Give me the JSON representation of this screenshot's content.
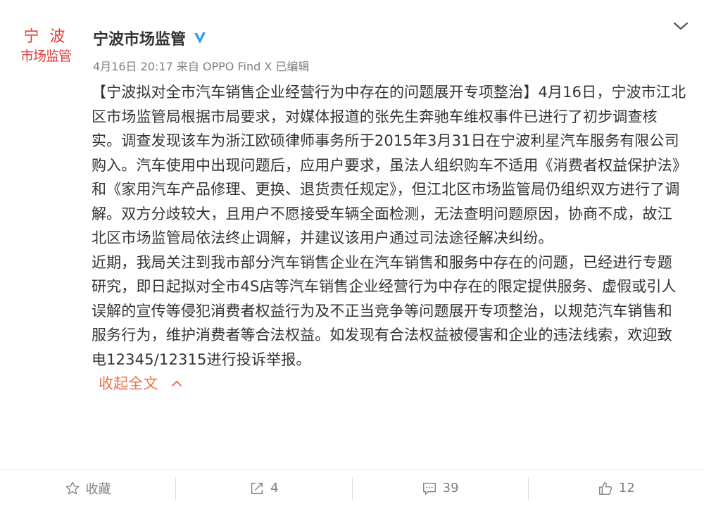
{
  "post": {
    "avatar_text_line1": "宁 波",
    "avatar_text_line2": "市场监管",
    "user_name": "宁波市场监管",
    "meta": "4月16日 20:17 来自 OPPO Find X   已编辑",
    "paragraph1": "【宁波拟对全市汽车销售企业经营行为中存在的问题展开专项整治】4月16日，宁波市江北区市场监管局根据市局要求，对媒体报道的张先生奔驰车维权事件已进行了初步调查核实。调查发现该车为浙江欧硕律师事务所于2015年3月31日在宁波利星汽车服务有限公司购入。汽车使用中出现问题后，应用户要求，虽法人组织购车不适用《消费者权益保护法》和《家用汽车产品修理、更换、退货责任规定》，但江北区市场监管局仍组织双方进行了调解。双方分歧较大，且用户不愿接受车辆全面检测，无法查明问题原因，协商不成，故江北区市场监管局依法终止调解，并建议该用户通过司法途径解决纠纷。",
    "paragraph2": "近期，我局关注到我市部分汽车销售企业在汽车销售和服务中存在的问题，已经进行专题研究，即日起拟对全市4S店等汽车销售企业经营行为中存在的限定提供服务、虚假或引人误解的宣传等侵犯消费者权益行为及不正当竞争等问题展开专项整治，以规范汽车销售和服务行为，维护消费者等合法权益。如发现有合法权益被侵害和企业的违法线索，欢迎致电12345/12315进行投诉举报。",
    "collapse_label": "收起全文"
  },
  "actions": {
    "favorite_label": "收藏",
    "repost_count": "4",
    "comment_count": "39",
    "like_count": "12"
  },
  "colors": {
    "accent_orange": "#eb7350",
    "verified_blue": "#2d9bf0",
    "avatar_red": "#e0403a"
  },
  "icons": [
    "verified-icon",
    "chevron-down-icon",
    "chevron-up-icon",
    "star-icon",
    "repost-icon",
    "comment-icon",
    "like-icon"
  ]
}
